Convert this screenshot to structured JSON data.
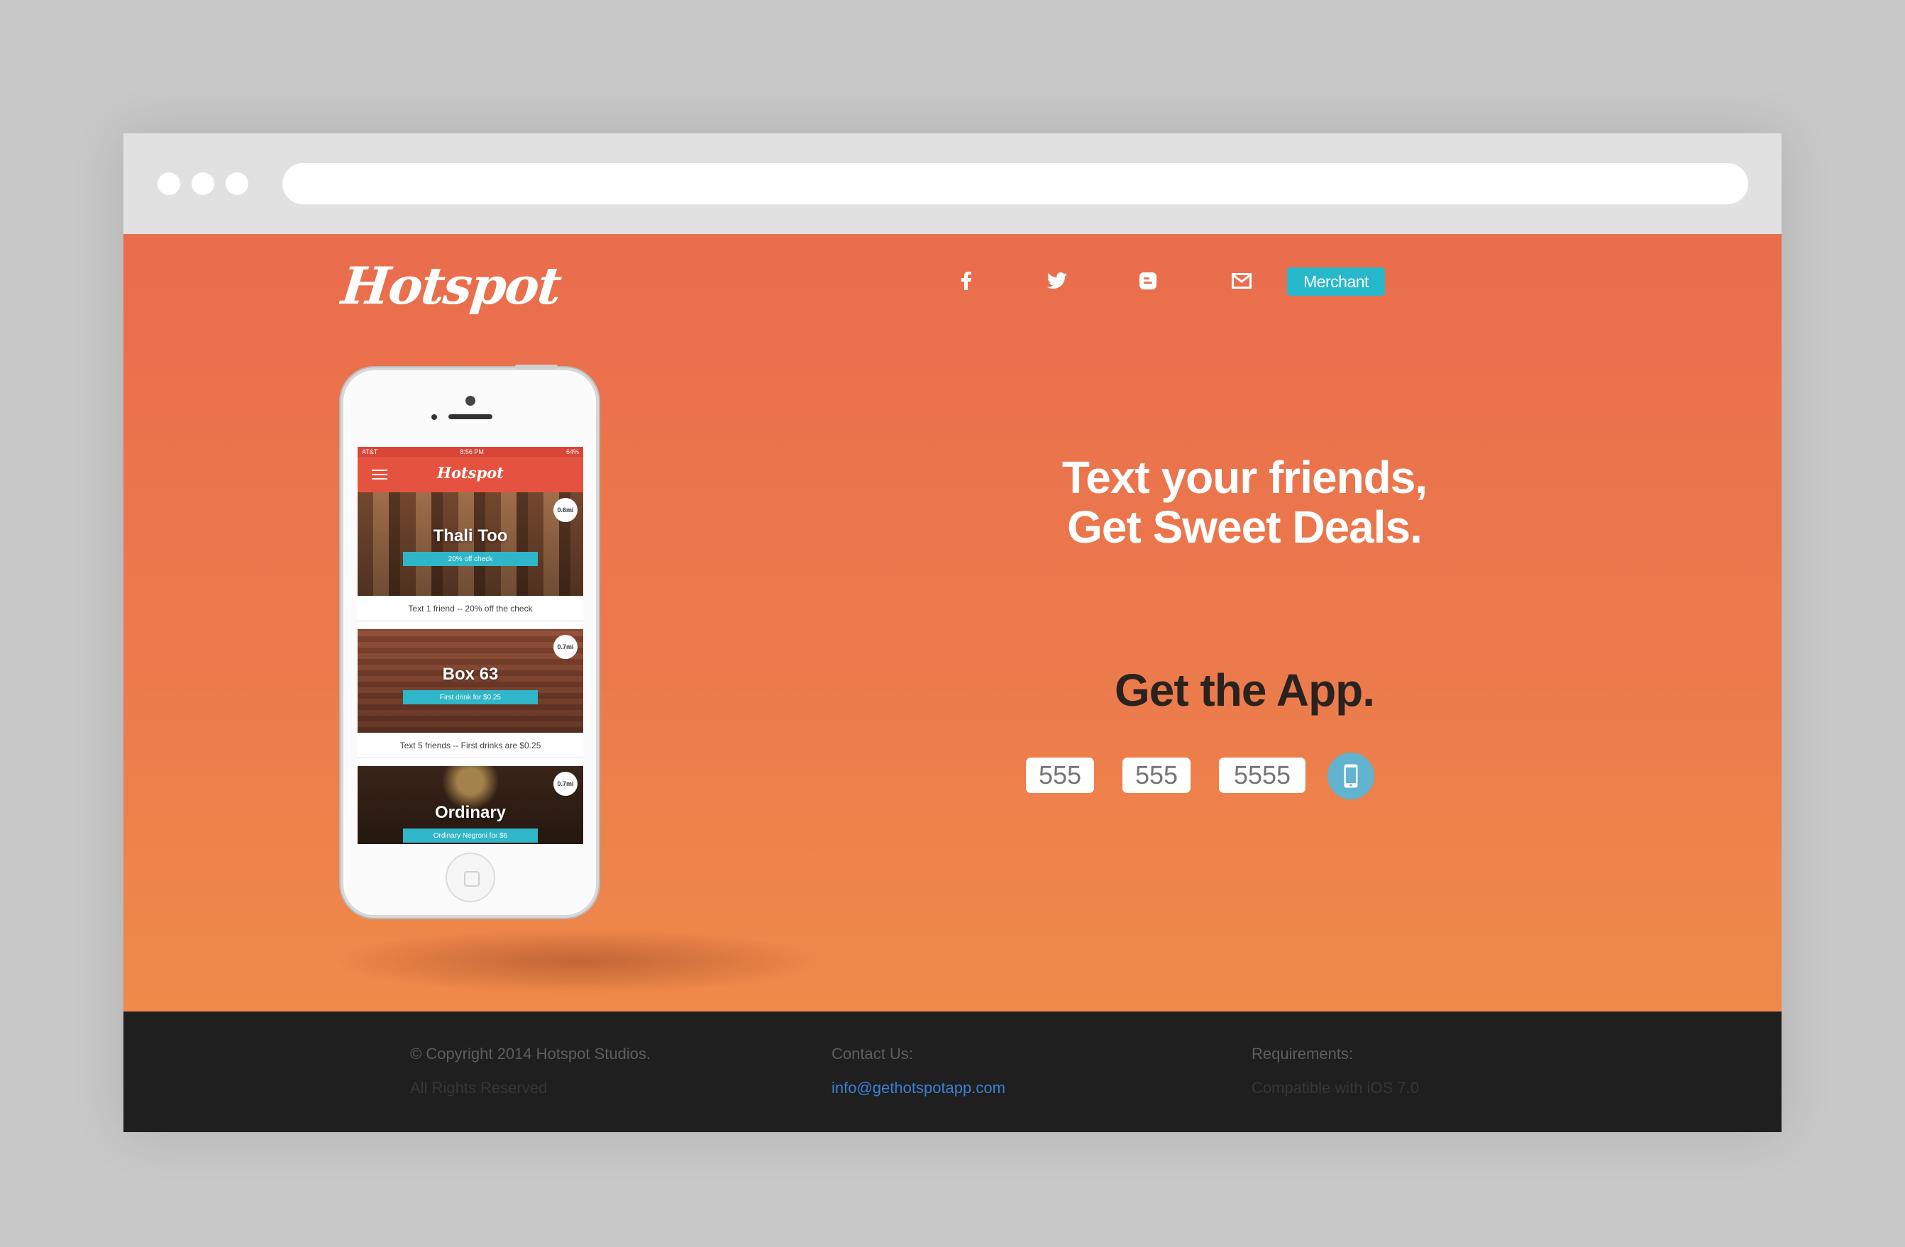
{
  "brand": {
    "logo": "Hotspot",
    "colors": {
      "hero_top": "#ea6d4d",
      "hero_bottom": "#ef8a4a",
      "accent": "#27b9cb",
      "footer_bg": "#1f1f1f",
      "send_button": "#62b3cf"
    }
  },
  "nav": {
    "icons": [
      "facebook-icon",
      "twitter-icon",
      "blogger-icon",
      "mail-icon"
    ],
    "merchant_label": "Merchant"
  },
  "hero": {
    "headline_line1": "Text your friends,",
    "headline_line2": "Get Sweet Deals.",
    "cta_title": "Get the App.",
    "phone_fields": [
      "555",
      "555",
      "5555"
    ],
    "send_icon": "phone-icon"
  },
  "phone_app": {
    "status_left": "AT&T",
    "status_time": "8:56 PM",
    "status_battery": "64%",
    "title": "Hotspot",
    "cards": [
      {
        "name": "Thali Too",
        "deal": "20% off check",
        "distance": "0.6mi",
        "caption": "Text 1 friend -- 20% off the check"
      },
      {
        "name": "Box 63",
        "deal": "First drink for $0.25",
        "distance": "0.7mi",
        "caption": "Text 5 friends -- First drinks are $0.25"
      },
      {
        "name": "Ordinary",
        "deal": "Ordinary Negroni for $6",
        "distance": "0.7mi",
        "caption": ""
      }
    ]
  },
  "footer": {
    "copyright": "© Copyright 2014 Hotspot Studios.",
    "rights": "All Rights Reserved",
    "contact_label": "Contact Us:",
    "contact_email": "info@gethotspotapp.com",
    "requirements_label": "Requirements:",
    "requirements_value": "Compatible with iOS 7.0"
  }
}
